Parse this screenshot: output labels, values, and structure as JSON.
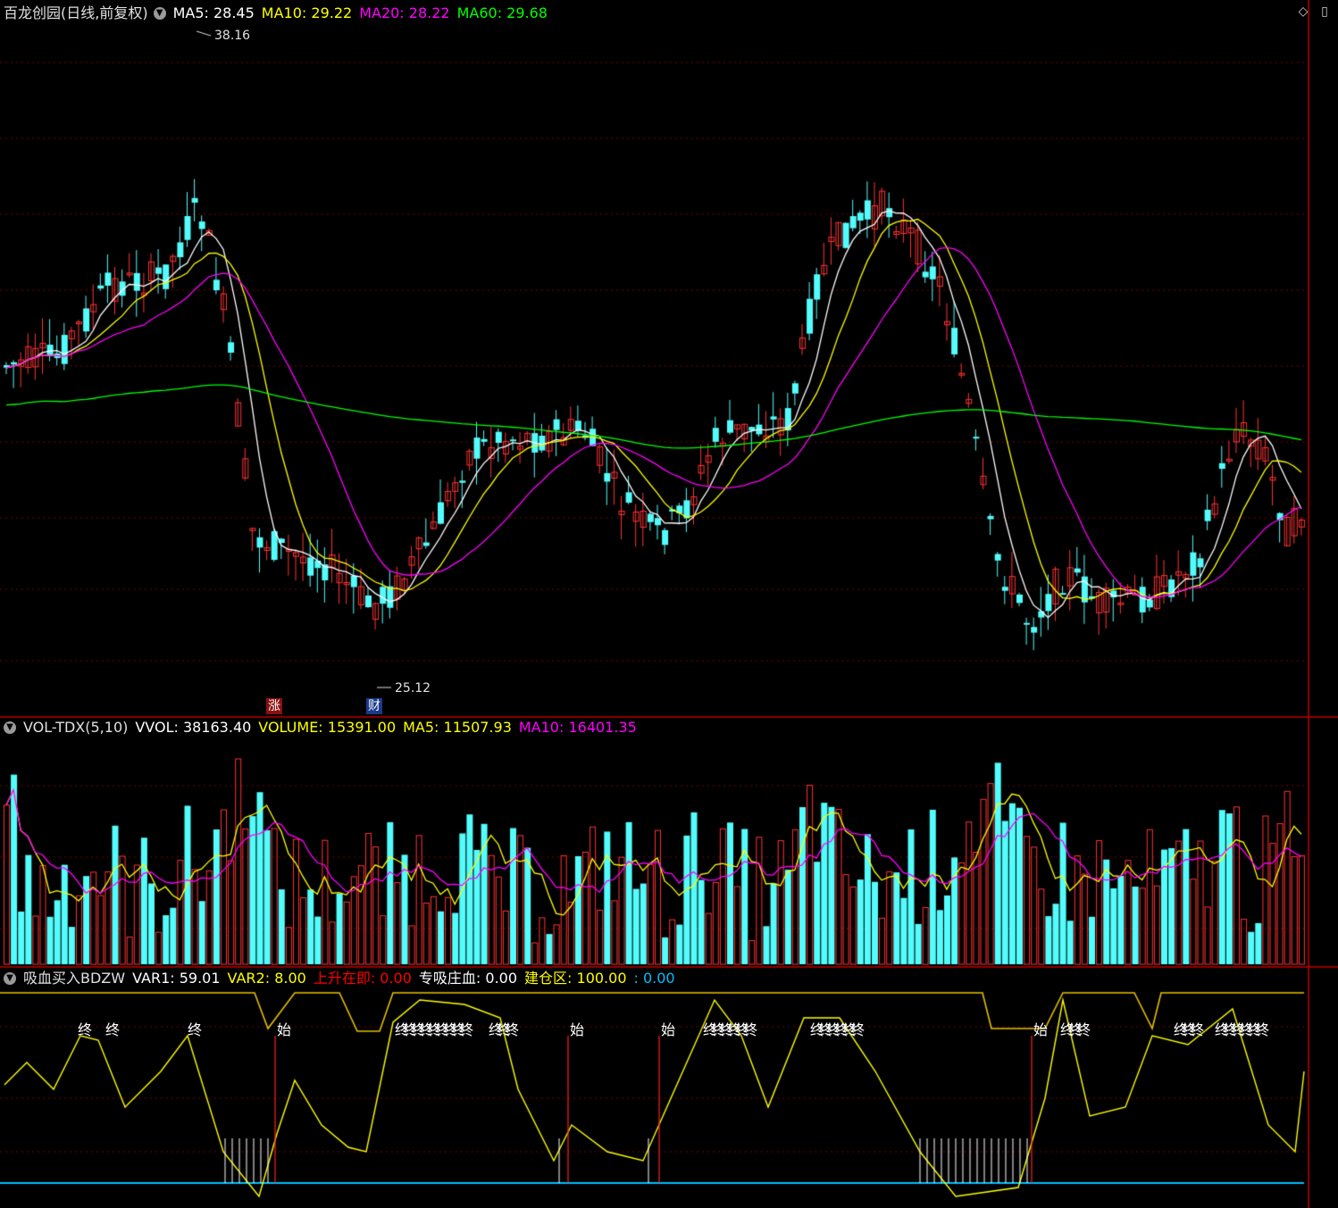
{
  "main_panel": {
    "title": "百龙创园(日线,前复权)",
    "indicators": [
      {
        "label": "MA5: 28.45",
        "color": "#ffffff"
      },
      {
        "label": "MA10: 29.22",
        "color": "#ffff00"
      },
      {
        "label": "MA20: 28.22",
        "color": "#ff00ff"
      },
      {
        "label": "MA60: 29.68",
        "color": "#00ff00"
      }
    ],
    "high_label": "38.16",
    "low_label": "25.12",
    "marker_zhang": "涨",
    "marker_cai": "财"
  },
  "volume_panel": {
    "title": "VOL-TDX(5,10)",
    "indicators": [
      {
        "label": "VVOL: 38163.40",
        "color": "#ffffff"
      },
      {
        "label": "VOLUME: 15391.00",
        "color": "#ffff00"
      },
      {
        "label": "MA5: 11507.93",
        "color": "#ffff00"
      },
      {
        "label": "MA10: 16401.35",
        "color": "#ff00ff"
      }
    ]
  },
  "indicator_panel": {
    "title": "吸血买入BDZW",
    "indicators": [
      {
        "label": "VAR1: 59.01",
        "color": "#ffffff"
      },
      {
        "label": "VAR2: 8.00",
        "color": "#ffff00"
      },
      {
        "label": "上升在即: 0.00",
        "color": "#ff0000"
      },
      {
        "label": "专吸庄血: 0.00",
        "color": "#ffffff"
      },
      {
        "label": "建仓区: 100.00",
        "color": "#ffff00"
      },
      {
        "label": ": 0.00",
        "color": "#00bfff"
      }
    ],
    "signal_end": "终",
    "signal_start": "始"
  },
  "colors": {
    "up": "#ff3232",
    "down": "#54fcfc",
    "ma5": "#ffffff",
    "ma10": "#ffff00",
    "ma20": "#ff00ff",
    "ma60": "#00ff00",
    "grid": "#7a0000",
    "divider": "#c00000"
  }
}
